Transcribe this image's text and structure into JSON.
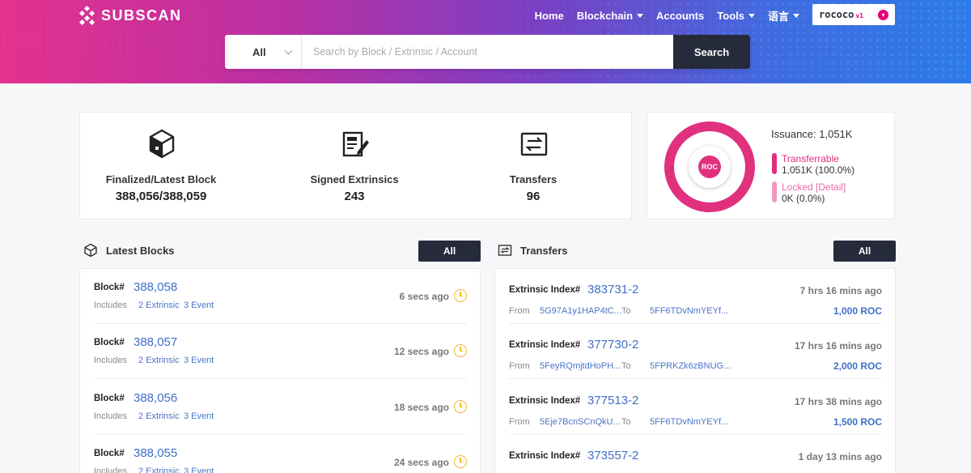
{
  "header": {
    "logo_text": "SUBSCAN",
    "nav": [
      {
        "label": "Home",
        "dropdown": false
      },
      {
        "label": "Blockchain",
        "dropdown": true
      },
      {
        "label": "Accounts",
        "dropdown": false
      },
      {
        "label": "Tools",
        "dropdown": true
      },
      {
        "label": "语言",
        "dropdown": true
      }
    ],
    "network": {
      "name": "rococo",
      "version": "v1"
    }
  },
  "search": {
    "filter": "All",
    "placeholder": "Search by Block / Extrinsic / Account",
    "button": "Search"
  },
  "stats": [
    {
      "label": "Finalized/Latest Block",
      "value": "388,056/388,059",
      "icon": "cube-icon"
    },
    {
      "label": "Signed Extrinsics",
      "value": "243",
      "icon": "document-edit-icon"
    },
    {
      "label": "Transfers",
      "value": "96",
      "icon": "transfer-icon"
    }
  ],
  "issuance": {
    "title": "Issuance: 1,051K",
    "token": "ROC",
    "transferrable_label": "Transferrable",
    "transferrable_value": "1,051K  (100.0%)",
    "locked_label": "Locked [Detail]",
    "locked_value": "0K  (0.0%)",
    "colors": {
      "transferrable": "#e0307e",
      "locked": "#f09ac0"
    }
  },
  "latest_blocks": {
    "title": "Latest Blocks",
    "all_label": "All",
    "items": [
      {
        "label": "Block#",
        "number": "388,058",
        "includes": "Includes",
        "extrinsic": "2 Extrinsic",
        "event": "3 Event",
        "time": "6 secs ago"
      },
      {
        "label": "Block#",
        "number": "388,057",
        "includes": "Includes",
        "extrinsic": "2 Extrinsic",
        "event": "3 Event",
        "time": "12 secs ago"
      },
      {
        "label": "Block#",
        "number": "388,056",
        "includes": "Includes",
        "extrinsic": "2 Extrinsic",
        "event": "3 Event",
        "time": "18 secs ago"
      },
      {
        "label": "Block#",
        "number": "388,055",
        "includes": "Includes",
        "extrinsic": "2 Extrinsic",
        "event": "3 Event",
        "time": "24 secs ago"
      }
    ]
  },
  "transfers": {
    "title": "Transfers",
    "all_label": "All",
    "items": [
      {
        "label": "Extrinsic Index#",
        "index": "383731-2",
        "time": "7 hrs 16 mins ago",
        "from_label": "From",
        "from": "5G97A1y1HAP4tC...",
        "to_label": "To",
        "to": "5FF6TDvNmYEYf...",
        "amount": "1,000 ROC"
      },
      {
        "label": "Extrinsic Index#",
        "index": "377730-2",
        "time": "17 hrs 16 mins ago",
        "from_label": "From",
        "from": "5FeyRQmjtdHoPH...",
        "to_label": "To",
        "to": "5FPRKZk6zBNUG...",
        "amount": "2,000 ROC"
      },
      {
        "label": "Extrinsic Index#",
        "index": "377513-2",
        "time": "17 hrs 38 mins ago",
        "from_label": "From",
        "from": "5Eje7BcnSCnQkU...",
        "to_label": "To",
        "to": "5FF6TDvNmYEYf...",
        "amount": "1,500 ROC"
      },
      {
        "label": "Extrinsic Index#",
        "index": "373557-2",
        "time": "1 day 13 mins ago",
        "from_label": "From",
        "from": "",
        "to_label": "To",
        "to": "",
        "amount": ""
      }
    ]
  }
}
